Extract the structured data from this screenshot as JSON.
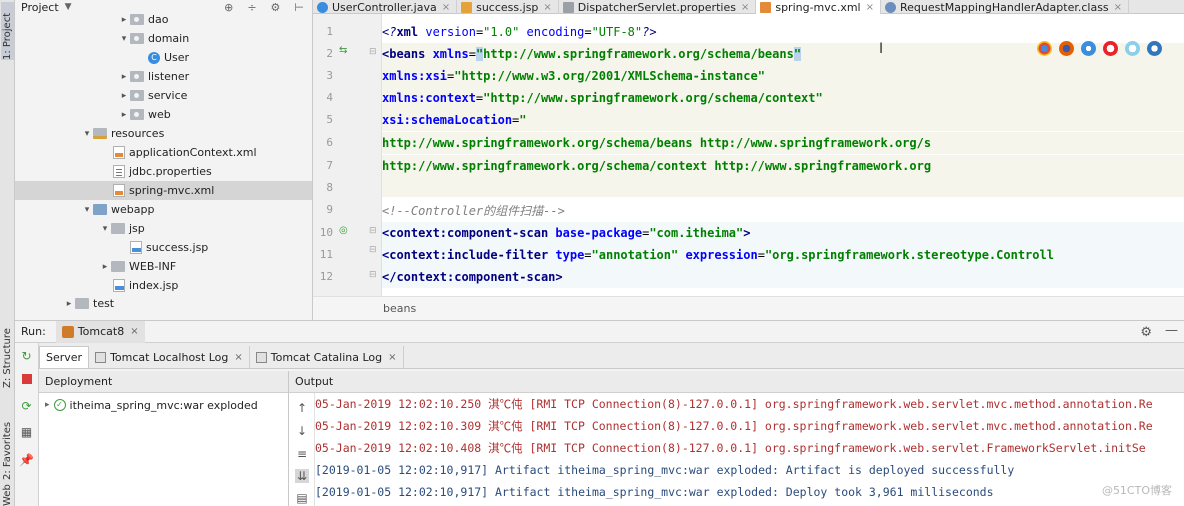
{
  "left_stripe": {
    "project_tab": "1: Project",
    "structure_tab": "Z: Structure",
    "favorites_tab": "2: Favorites",
    "web_tab": "Web"
  },
  "project": {
    "title": "Project",
    "tree": [
      {
        "label": "dao",
        "icon": "package-folder"
      },
      {
        "label": "domain",
        "icon": "package-folder"
      },
      {
        "label": "User",
        "icon": "class-icon"
      },
      {
        "label": "listener",
        "icon": "package-folder"
      },
      {
        "label": "service",
        "icon": "package-folder"
      },
      {
        "label": "web",
        "icon": "package-folder"
      },
      {
        "label": "resources",
        "icon": "resources-folder"
      },
      {
        "label": "applicationContext.xml",
        "icon": "xml-file"
      },
      {
        "label": "jdbc.properties",
        "icon": "properties-file"
      },
      {
        "label": "spring-mvc.xml",
        "icon": "xml-file"
      },
      {
        "label": "webapp",
        "icon": "web-folder"
      },
      {
        "label": "jsp",
        "icon": "folder"
      },
      {
        "label": "success.jsp",
        "icon": "jsp-file"
      },
      {
        "label": "WEB-INF",
        "icon": "folder"
      },
      {
        "label": "index.jsp",
        "icon": "jsp-file"
      },
      {
        "label": "test",
        "icon": "folder"
      }
    ]
  },
  "editor_tabs": [
    {
      "label": "UserController.java",
      "icon": "java"
    },
    {
      "label": "success.jsp",
      "icon": "jsp"
    },
    {
      "label": "DispatcherServlet.properties",
      "icon": "prop"
    },
    {
      "label": "spring-mvc.xml",
      "icon": "xml",
      "active": true
    },
    {
      "label": "RequestMappingHandlerAdapter.class",
      "icon": "cls2"
    }
  ],
  "editor": {
    "line_numbers": [
      "1",
      "2",
      "3",
      "4",
      "5",
      "6",
      "7",
      "8",
      "9",
      "10",
      "11",
      "12"
    ],
    "l1": {
      "a": "<?",
      "b": "xml ",
      "c": "version",
      "d": "=",
      "e": "\"1.0\"",
      "f": " encoding",
      "g": "=",
      "h": "\"UTF-8\"",
      "i": "?>"
    },
    "l2": {
      "tag": "<beans ",
      "attr": "xmlns",
      "eq": "=",
      "q": "\"",
      "val": "http://www.springframework.org/schema/beans",
      "q2": "\""
    },
    "l3": {
      "attr": "xmlns:xsi",
      "eq": "=",
      "val": "\"http://www.w3.org/2001/XMLSchema-instance\""
    },
    "l4": {
      "attr": "xmlns:context",
      "eq": "=",
      "val": "\"http://www.springframework.org/schema/context\""
    },
    "l5": {
      "attr": "xsi:schemaLocation",
      "eq": "=",
      "val": "\""
    },
    "l6": {
      "val": "http://www.springframework.org/schema/beans http://www.springframework.org/s"
    },
    "l7": {
      "val": "http://www.springframework.org/schema/context http://www.springframework.org"
    },
    "l9": {
      "comment": "<!--Controller的组件扫描-->"
    },
    "l10": {
      "tag": "<context:component-scan ",
      "attr": "base-package",
      "eq": "=",
      "val": "\"com.itheima\"",
      "close": ">"
    },
    "l11": {
      "tag": "<context:include-filter ",
      "attr1": "type",
      "eq1": "=",
      "val1": "\"annotation\"",
      "attr2": " expression",
      "eq2": "=",
      "val2": "\"org.springframework.stereotype.Controll"
    },
    "l12": {
      "tag": "</context:component-scan>"
    }
  },
  "breadcrumb": "beans",
  "run": {
    "label": "Run:",
    "config": "Tomcat8",
    "tabs": [
      "Server",
      "Tomcat Localhost Log",
      "Tomcat Catalina Log"
    ],
    "deployment_header": "Deployment",
    "output_header": "Output",
    "deployment_item": "itheima_spring_mvc:war exploded",
    "log": [
      {
        "text": "05-Jan-2019 12:02:10.250 淇℃伅 [RMI TCP Connection(8)-127.0.0.1] org.springframework.web.servlet.mvc.method.annotation.Re",
        "level": "err"
      },
      {
        "text": "05-Jan-2019 12:02:10.309 淇℃伅 [RMI TCP Connection(8)-127.0.0.1] org.springframework.web.servlet.mvc.method.annotation.Re",
        "level": "err"
      },
      {
        "text": "05-Jan-2019 12:02:10.408 淇℃伅 [RMI TCP Connection(8)-127.0.0.1] org.springframework.web.servlet.FrameworkServlet.initSe",
        "level": "err"
      },
      {
        "text": "[2019-01-05 12:02:10,917] Artifact itheima_spring_mvc:war exploded: Artifact is deployed successfully",
        "level": "info"
      },
      {
        "text": "[2019-01-05 12:02:10,917] Artifact itheima_spring_mvc:war exploded: Deploy took 3,961 milliseconds",
        "level": "info"
      }
    ]
  },
  "watermark": "@51CTO博客",
  "colors": {
    "xml_tag": "#000080",
    "xml_attr": "#0000ff",
    "xml_value": "#008000",
    "log_error": "#b03030",
    "log_info": "#2a4b7c"
  }
}
